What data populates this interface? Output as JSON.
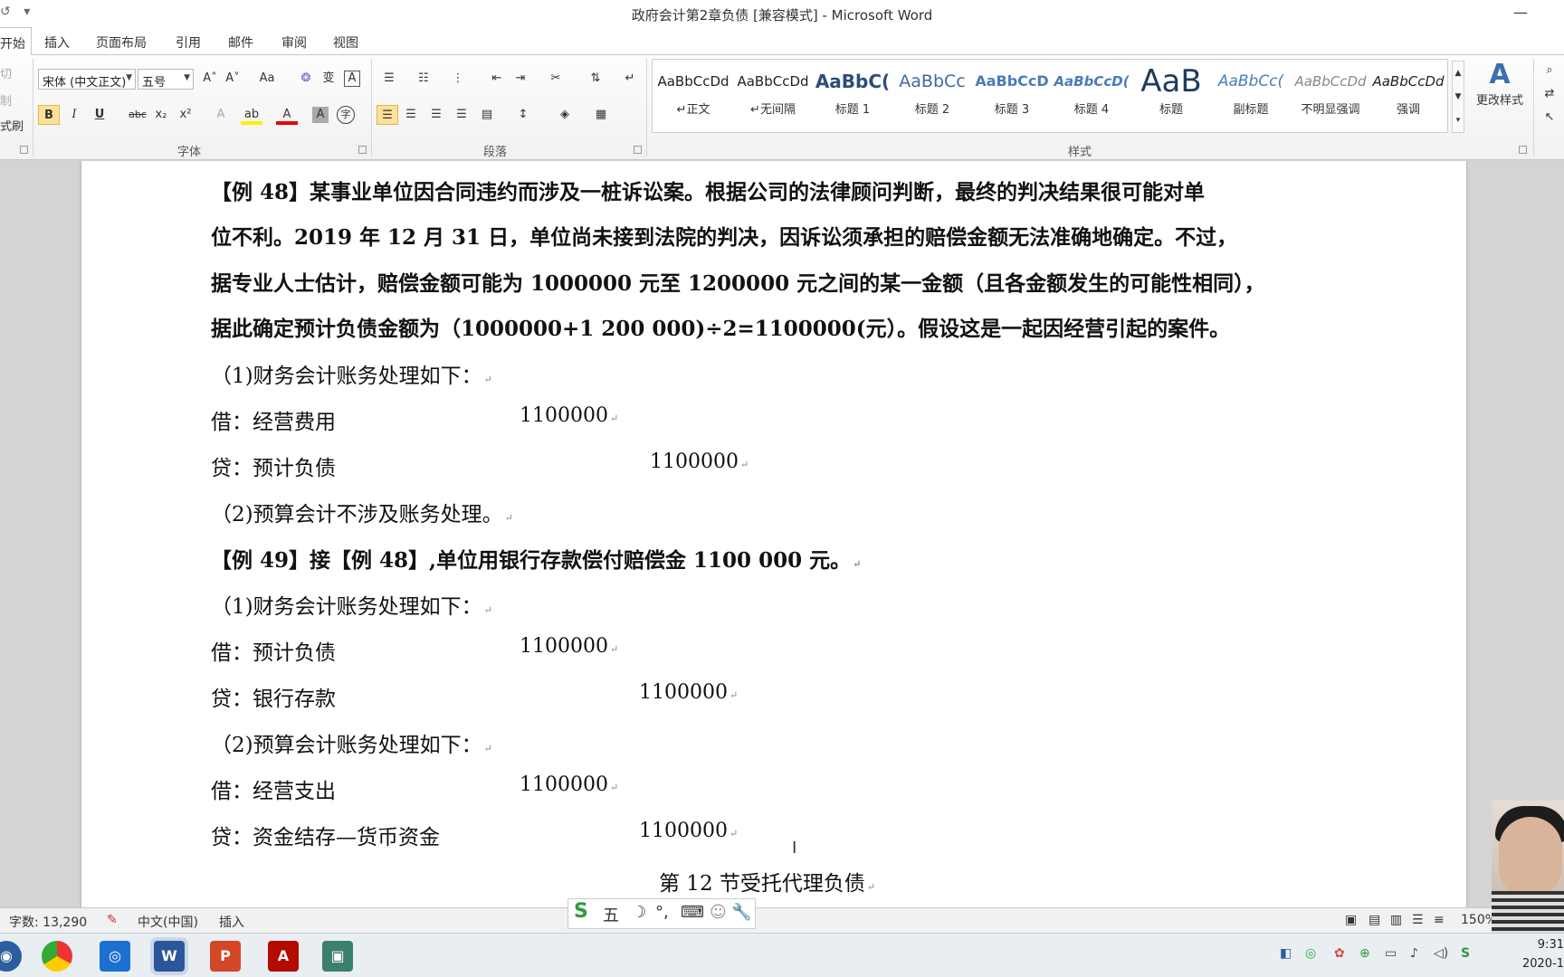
{
  "window": {
    "title": "政府会计第2章负债 [兼容模式] - Microsoft Word",
    "min_glyph": "—"
  },
  "qat": {
    "undo": "↺",
    "customize": "▾"
  },
  "tabs": [
    "开始",
    "插入",
    "页面布局",
    "引用",
    "邮件",
    "审阅",
    "视图"
  ],
  "clipboard": {
    "cut": "切",
    "copy": "制",
    "format_painter": "式刷"
  },
  "font": {
    "family": "宋体 (中文正文)",
    "size": "五号",
    "group_label": "字体",
    "grow": "A˄",
    "shrink": "A˅",
    "case": "Aa",
    "clear": "❂",
    "phonetic": "变",
    "border": "A",
    "bold": "B",
    "italic": "I",
    "underline": "U",
    "strike": "abc",
    "sub": "x₂",
    "sup": "x²",
    "effects": "A",
    "highlight": "ab",
    "color": "A",
    "shade": "A",
    "enclose": "字"
  },
  "paragraph": {
    "group_label": "段落"
  },
  "styles": {
    "group_label": "样式",
    "change_styles": "更改样式",
    "items": [
      {
        "preview": "AaBbCcDd",
        "name": "↵正文"
      },
      {
        "preview": "AaBbCcDd",
        "name": "↵无间隔"
      },
      {
        "preview": "AaBbC(",
        "name": "标题 1"
      },
      {
        "preview": "AaBbCc",
        "name": "标题 2"
      },
      {
        "preview": "AaBbCcD",
        "name": "标题 3"
      },
      {
        "preview": "AaBbCcD(",
        "name": "标题 4"
      },
      {
        "preview": "AaB",
        "name": "标题"
      },
      {
        "preview": "AaBbCc(",
        "name": "副标题"
      },
      {
        "preview": "AaBbCcDd",
        "name": "不明显强调"
      },
      {
        "preview": "AaBbCcDd",
        "name": "强调"
      }
    ]
  },
  "document": {
    "para1": [
      "【例 48】某事业单位因合同违约而涉及一桩诉讼案。根据公司的法律顾问判断，最终的判决结果很可能对单",
      "位不利。2019 年 12 月 31 日，单位尚未接到法院的判决，因诉讼须承担的赔偿金额无法准确地确定。不过，",
      "据专业人士估计，赔偿金额可能为 1000000 元至 1200000 元之间的某一金额（且各金额发生的可能性相同），",
      "据此确定预计负债金额为（1000000+1 200 000)÷2=1100000(元）。假设这是一起因经营引起的案件。"
    ],
    "e48_fin_head": "（1)财务会计账务处理如下：",
    "e48_debit": "借：经营费用",
    "e48_debit_amt": "1100000",
    "e48_credit": "贷：预计负债",
    "e48_credit_amt": "1100000",
    "e48_budget": "（2)预算会计不涉及账务处理。",
    "e49_head": "【例 49】接【例 48】,单位用银行存款偿付赔偿金 1100 000 元。",
    "e49_fin_head": "（1)财务会计账务处理如下：",
    "e49_debit": "借：预计负债",
    "e49_debit_amt": "1100000",
    "e49_credit": "贷：银行存款",
    "e49_credit_amt": "1100000",
    "e49_budget_head": "（2)预算会计账务处理如下：",
    "e49_b_debit": "借：经营支出",
    "e49_b_debit_amt": "1100000",
    "e49_b_credit": "贷：资金结存—货币资金",
    "e49_b_credit_amt": "1100000",
    "section_heading": "第 12 节受托代理负债",
    "para_mark": "↵"
  },
  "status": {
    "word_count": "字数: 13,290",
    "language": "中文(中国)",
    "mode": "插入",
    "zoom": "150%"
  },
  "ime": {
    "logo": "S",
    "mode": "五",
    "moon": "☽",
    "punct": "°,",
    "keyboard": "⌨",
    "user": "☺",
    "tools": "🔧"
  },
  "taskbar": {
    "apps": [
      "Chrome",
      "Baidu",
      "Word",
      "PowerPoint",
      "Acrobat",
      "Viewer"
    ],
    "time": "9:31",
    "date": "2020-1"
  }
}
